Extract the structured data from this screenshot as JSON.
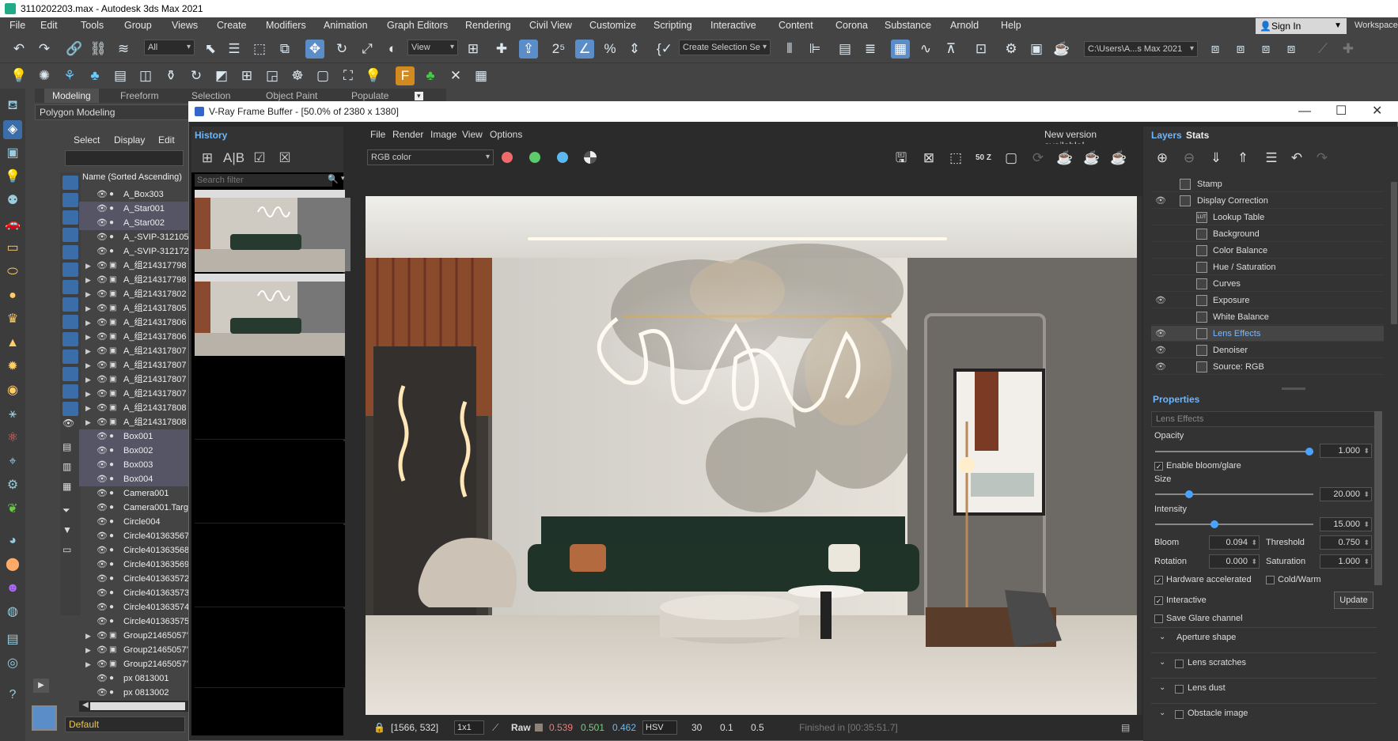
{
  "app_title": "3110202203.max - Autodesk 3ds Max 2021",
  "menu": [
    "File",
    "Edit",
    "Tools",
    "Group",
    "Views",
    "Create",
    "Modifiers",
    "Animation",
    "Graph Editors",
    "Rendering",
    "Civil View",
    "Customize",
    "Scripting",
    "Interactive",
    "Content",
    "Corona",
    "Substance",
    "Arnold",
    "Help"
  ],
  "signin": "Sign In",
  "workspace": "Workspace",
  "toolbar": {
    "filter_all": "All",
    "view": "View",
    "selection_set": "Create Selection Se",
    "path": "C:\\Users\\A...s Max 2021"
  },
  "ribbon": {
    "tabs": [
      "Modeling",
      "Freeform",
      "Selection",
      "Object Paint",
      "Populate"
    ],
    "panel": "Polygon Modeling"
  },
  "scene_explorer": {
    "menu": [
      "Select",
      "Display",
      "Edit"
    ],
    "column": "Name (Sorted Ascending)",
    "items": [
      {
        "name": "A_Box303",
        "expand": false
      },
      {
        "name": "A_Star001",
        "expand": false
      },
      {
        "name": "A_Star002",
        "expand": false
      },
      {
        "name": "A_-SVIP-312105",
        "expand": false
      },
      {
        "name": "A_-SVIP-312172",
        "expand": false
      },
      {
        "name": "A_组214317798",
        "expand": true
      },
      {
        "name": "A_组214317798",
        "expand": true
      },
      {
        "name": "A_组214317802",
        "expand": true
      },
      {
        "name": "A_组214317805",
        "expand": true
      },
      {
        "name": "A_组214317806",
        "expand": true
      },
      {
        "name": "A_组214317806",
        "expand": true
      },
      {
        "name": "A_组214317807",
        "expand": true
      },
      {
        "name": "A_组214317807",
        "expand": true
      },
      {
        "name": "A_组214317807",
        "expand": true
      },
      {
        "name": "A_组214317807",
        "expand": true
      },
      {
        "name": "A_组214317808",
        "expand": true
      },
      {
        "name": "A_组214317808",
        "expand": true
      },
      {
        "name": "Box001",
        "expand": false
      },
      {
        "name": "Box002",
        "expand": false
      },
      {
        "name": "Box003",
        "expand": false
      },
      {
        "name": "Box004",
        "expand": false
      },
      {
        "name": "Camera001",
        "expand": false
      },
      {
        "name": "Camera001.Targ",
        "expand": false
      },
      {
        "name": "Circle004",
        "expand": false
      },
      {
        "name": "Circle401363567",
        "expand": false
      },
      {
        "name": "Circle401363568",
        "expand": false
      },
      {
        "name": "Circle401363569",
        "expand": false
      },
      {
        "name": "Circle401363572",
        "expand": false
      },
      {
        "name": "Circle401363573",
        "expand": false
      },
      {
        "name": "Circle401363574",
        "expand": false
      },
      {
        "name": "Circle401363575",
        "expand": false
      },
      {
        "name": "Group21465057’",
        "expand": true
      },
      {
        "name": "Group21465057’",
        "expand": true
      },
      {
        "name": "Group21465057’",
        "expand": true
      },
      {
        "name": "px 0813001",
        "expand": false
      },
      {
        "name": "px 0813002",
        "expand": false
      }
    ],
    "layer": "Default"
  },
  "vfb": {
    "title": "V-Ray Frame Buffer - [50.0% of 2380 x 1380]",
    "menu": [
      "File",
      "Render",
      "Image",
      "View",
      "Options"
    ],
    "new_version": "New version available!",
    "channel": "RGB color",
    "history": {
      "title": "History",
      "search_placeholder": "Search filter"
    },
    "status": {
      "coords": "[1566, 532]",
      "ratio": "1x1",
      "mode": "Raw",
      "r": "0.539",
      "g": "0.501",
      "b": "0.462",
      "space": "HSV",
      "v1": "30",
      "v2": "0.1",
      "v3": "0.5",
      "finished": "Finished in [00:35:51.7]"
    },
    "zoom_badge": "50 Z"
  },
  "layers_panel": {
    "tabs": [
      "Layers",
      "Stats"
    ],
    "layers": [
      {
        "name": "Stamp",
        "eye": false,
        "indent": false
      },
      {
        "name": "Display Correction",
        "eye": true,
        "indent": false
      },
      {
        "name": "Lookup Table",
        "eye": false,
        "indent": true
      },
      {
        "name": "Background",
        "eye": false,
        "indent": true
      },
      {
        "name": "Color Balance",
        "eye": false,
        "indent": true
      },
      {
        "name": "Hue / Saturation",
        "eye": false,
        "indent": true
      },
      {
        "name": "Curves",
        "eye": false,
        "indent": true
      },
      {
        "name": "Exposure",
        "eye": true,
        "indent": true
      },
      {
        "name": "White Balance",
        "eye": false,
        "indent": true
      },
      {
        "name": "Lens Effects",
        "eye": true,
        "indent": true,
        "selected": true
      },
      {
        "name": "Denoiser",
        "eye": true,
        "indent": true
      },
      {
        "name": "Source: RGB",
        "eye": true,
        "indent": true
      }
    ],
    "lut_badge": "LUT",
    "properties": {
      "title": "Properties",
      "section": "Lens Effects",
      "opacity_label": "Opacity",
      "opacity": "1.000",
      "opacity_frac": 1.0,
      "enable_bloom": "Enable bloom/glare",
      "size_label": "Size",
      "size": "20.000",
      "size_frac": 0.2,
      "intensity_label": "Intensity",
      "intensity": "15.000",
      "intensity_frac": 0.37,
      "bloom_label": "Bloom",
      "bloom": "0.094",
      "threshold_label": "Threshold",
      "threshold": "0.750",
      "rotation_label": "Rotation",
      "rotation": "0.000",
      "saturation_label": "Saturation",
      "saturation": "1.000",
      "hw_accel": "Hardware accelerated",
      "coldwarm": "Cold/Warm",
      "interactive": "Interactive",
      "update": "Update",
      "save_glare": "Save Glare channel",
      "aperture": "Aperture shape",
      "scratches": "Lens scratches",
      "dust": "Lens dust",
      "obstacle": "Obstacle image"
    }
  }
}
